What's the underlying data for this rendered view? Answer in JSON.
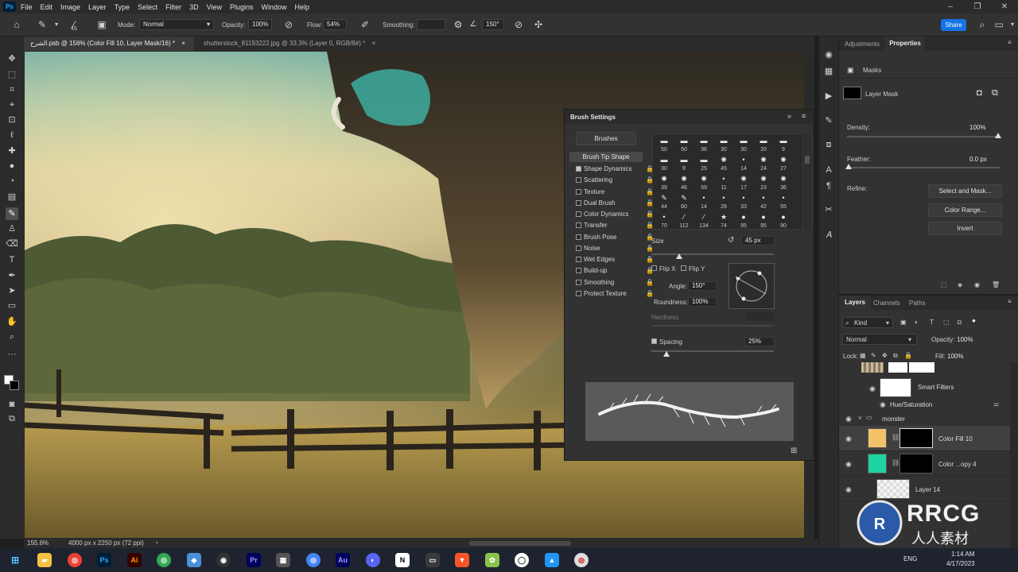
{
  "app": {
    "logo": "Ps"
  },
  "menu": [
    "File",
    "Edit",
    "Image",
    "Layer",
    "Type",
    "Select",
    "Filter",
    "3D",
    "View",
    "Plugins",
    "Window",
    "Help"
  ],
  "options": {
    "brush_size": "45",
    "mode_label": "Mode:",
    "mode_value": "Normal",
    "opacity_label": "Opacity:",
    "opacity_value": "100%",
    "flow_label": "Flow:",
    "flow_value": "54%",
    "smoothing_label": "Smoothing:",
    "angle_value": "150°",
    "share_label": "Share"
  },
  "tabs": [
    {
      "label": "الشرح.psb @ 156% (Color Fill 10, Layer Mask/16) *"
    },
    {
      "label": "shutterstock_81193222.jpg @ 33.3% (Layer 0, RGB/8#) *"
    }
  ],
  "status": {
    "zoom": "155.6%",
    "doc_size": "4000 px x 2250 px (72 ppi)"
  },
  "brush_settings": {
    "title": "Brush Settings",
    "brushes_button": "Brushes",
    "tip_shape": "Brush Tip Shape",
    "options": [
      {
        "label": "Shape Dynamics",
        "checked": true
      },
      {
        "label": "Scattering",
        "checked": false
      },
      {
        "label": "Texture",
        "checked": false
      },
      {
        "label": "Dual Brush",
        "checked": false
      },
      {
        "label": "Color Dynamics",
        "checked": false
      },
      {
        "label": "Transfer",
        "checked": false
      },
      {
        "label": "Brush Pose",
        "checked": false
      },
      {
        "label": "Noise",
        "checked": false
      },
      {
        "label": "Wet Edges",
        "checked": false
      },
      {
        "label": "Build-up",
        "checked": false
      },
      {
        "label": "Smoothing",
        "checked": false
      },
      {
        "label": "Protect Texture",
        "checked": false
      }
    ],
    "tip_sizes": [
      "50",
      "50",
      "36",
      "30",
      "30",
      "20",
      "9",
      "30",
      "9",
      "25",
      "45",
      "14",
      "24",
      "27",
      "39",
      "46",
      "59",
      "11",
      "17",
      "23",
      "36",
      "44",
      "60",
      "14",
      "26",
      "33",
      "42",
      "55",
      "70",
      "112",
      "134",
      "74",
      "95",
      "95",
      "90"
    ],
    "size_label": "Size",
    "size_value": "45 px",
    "flip_x": "Flip X",
    "flip_y": "Flip Y",
    "angle_label": "Angle:",
    "angle_value": "150°",
    "roundness_label": "Roundness:",
    "roundness_value": "100%",
    "hardness_label": "Hardness",
    "spacing_label": "Spacing",
    "spacing_value": "25%"
  },
  "properties": {
    "tab_adjustments": "Adjustments",
    "tab_properties": "Properties",
    "masks_label": "Masks",
    "layer_mask_label": "Layer Mask",
    "density_label": "Density:",
    "density_value": "100%",
    "feather_label": "Feather:",
    "feather_value": "0.0 px",
    "refine_label": "Refine:",
    "select_mask": "Select and Mask...",
    "color_range": "Color Range...",
    "invert": "Invert"
  },
  "layers": {
    "tab_layers": "Layers",
    "tab_channels": "Channels",
    "tab_paths": "Paths",
    "filter_kind": "Kind",
    "blend_mode": "Normal",
    "opacity_label": "Opacity:",
    "opacity_value": "100%",
    "lock_label": "Lock:",
    "fill_label": "Fill:",
    "fill_value": "100%",
    "smart_filters": "Smart Filters",
    "hue_saturation": "Hue/Saturation",
    "group_name": "monster",
    "rows": [
      {
        "name": "Color Fill 10",
        "swatch": "#f2c26b"
      },
      {
        "name": "Color ...opy 4",
        "swatch": "#1fd3a0"
      },
      {
        "name": "Layer 14",
        "swatch": "#dcdcdc"
      }
    ]
  },
  "taskbar": {
    "lang": "ENG",
    "time": "1:14 AM",
    "date": "4/17/2023"
  },
  "watermark": {
    "brand": "RRCG",
    "sub": "人人素材"
  },
  "colors": {
    "accent": "#1473e6",
    "panel": "#323232",
    "ps_blue": "#31a8ff"
  }
}
